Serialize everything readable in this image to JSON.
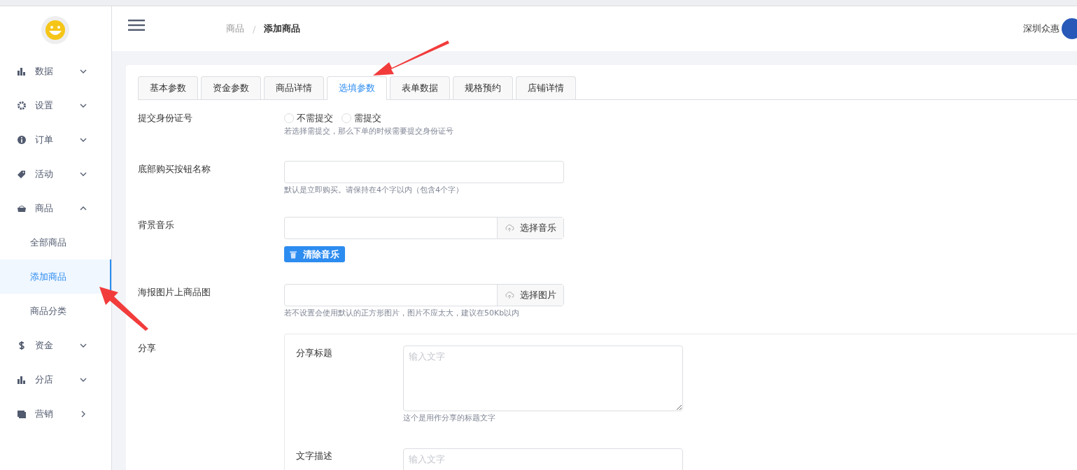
{
  "header": {
    "separator": "/",
    "breadcrumb": [
      {
        "label": "商品",
        "selected": false
      },
      {
        "label": "添加商品",
        "selected": true
      }
    ],
    "user": "深圳众惠"
  },
  "sidebar": {
    "items": [
      {
        "label": "数据",
        "kind": "submenu",
        "expanded": false
      },
      {
        "label": "设置",
        "kind": "submenu",
        "expanded": false
      },
      {
        "label": "订单",
        "kind": "submenu",
        "expanded": false
      },
      {
        "label": "活动",
        "kind": "submenu",
        "expanded": false
      },
      {
        "label": "商品",
        "kind": "submenu",
        "expanded": true,
        "children": [
          {
            "label": "全部商品",
            "selected": false
          },
          {
            "label": "添加商品",
            "selected": true
          },
          {
            "label": "商品分类",
            "selected": false
          }
        ]
      },
      {
        "label": "资金",
        "kind": "submenu",
        "expanded": false
      },
      {
        "label": "分店",
        "kind": "submenu",
        "expanded": false
      },
      {
        "label": "营销",
        "kind": "link",
        "expanded": false
      }
    ]
  },
  "tabs": [
    {
      "label": "基本参数",
      "selected": false
    },
    {
      "label": "资金参数",
      "selected": false
    },
    {
      "label": "商品详情",
      "selected": false
    },
    {
      "label": "选填参数",
      "selected": true
    },
    {
      "label": "表单数据",
      "selected": false
    },
    {
      "label": "规格预约",
      "selected": false
    },
    {
      "label": "店铺详情",
      "selected": false
    }
  ],
  "form": [
    {
      "kind": "radio",
      "label": "提交身份证号",
      "options": [
        {
          "label": "不需提交",
          "selected": false
        },
        {
          "label": "需提交",
          "selected": false
        }
      ],
      "help": "若选择需提交，那么下单的时候需要提交身份证号"
    },
    {
      "kind": "input",
      "label": "底部购买按钮名称",
      "help": "默认是立即购买。请保持在4个字以内（包含4个字）"
    },
    {
      "kind": "file",
      "label": "背景音乐",
      "button": "选择音乐",
      "action": "清除音乐"
    },
    {
      "kind": "file",
      "label": "海报图片上商品图",
      "button": "选择图片",
      "help": "若不设置会使用默认的正方形图片，图片不应太大，建议在50Kb以内"
    },
    {
      "kind": "group",
      "label": "分享",
      "fields": [
        {
          "label": "分享标题",
          "placeholder": "输入文字",
          "help": "这个是用作分享的标题文字"
        },
        {
          "label": "文字描述",
          "placeholder": "输入文字"
        }
      ]
    }
  ]
}
